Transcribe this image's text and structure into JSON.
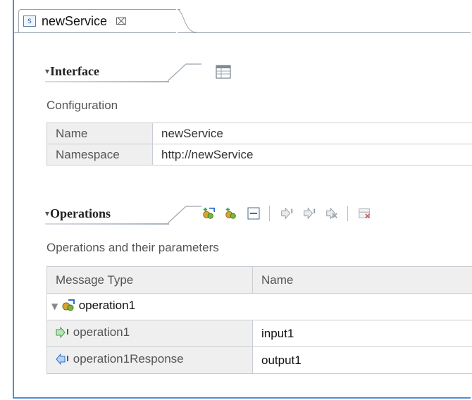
{
  "editor_tab": {
    "title": "newService",
    "close_glyph": "⌧",
    "icon_label": "S"
  },
  "interface_section": {
    "title": "Interface",
    "caption": "Configuration",
    "rows": [
      {
        "label": "Name",
        "value": "newService"
      },
      {
        "label": "Namespace",
        "value": "http://newService"
      }
    ]
  },
  "operations_section": {
    "title": "Operations",
    "caption": "Operations and their parameters",
    "toolbar_icons": [
      "add-operation-icon",
      "add-request-response-icon",
      "collapse-all-icon",
      "add-input-icon",
      "add-output-icon",
      "remove-parameter-icon",
      "show-fault-icon"
    ],
    "columns": [
      "Message Type",
      "Name"
    ],
    "operation": {
      "name": "operation1",
      "messages": [
        {
          "type": "operation1",
          "name": "input1",
          "kind": "input"
        },
        {
          "type": "operation1Response",
          "name": "output1",
          "kind": "output"
        }
      ]
    }
  },
  "colors": {
    "frame_border": "#4a90d9",
    "header_fill": "#efefef",
    "grid_border": "#c8cdd3",
    "input_arrow": "#3aa14a",
    "output_arrow": "#2f6fc9"
  }
}
